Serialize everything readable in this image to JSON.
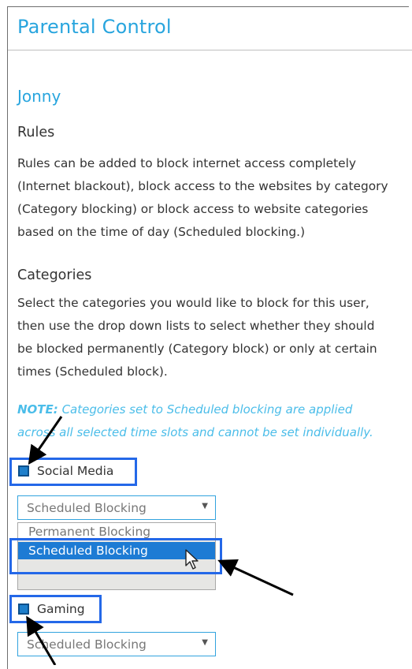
{
  "page": {
    "title": "Parental Control"
  },
  "user": {
    "name": "Jonny"
  },
  "rules": {
    "heading": "Rules",
    "lines": [
      "Rules can be added to block internet access completely",
      "(Internet blackout), block access to the websites by category",
      "(Category blocking) or block access to website categories",
      "based on the time of day (Scheduled blocking.)"
    ]
  },
  "categories": {
    "heading": "Categories",
    "lines": [
      "Select the categories you would like to block for this user,",
      "then use the drop down lists to select whether they should",
      "be blocked permanently (Category block) or only at certain",
      "times (Scheduled block)."
    ]
  },
  "note": {
    "prefix": "NOTE:",
    "line1": " Categories set to Scheduled blocking are applied",
    "line2": "across all selected time slots and cannot be set individually."
  },
  "social_media": {
    "label": "Social Media",
    "checked": true,
    "select_value": "Scheduled Blocking",
    "options": [
      "Permanent Blocking",
      "Scheduled Blocking"
    ],
    "highlighted_option": "Scheduled Blocking"
  },
  "gaming": {
    "label": "Gaming",
    "checked": true,
    "select_value": "Scheduled Blocking"
  },
  "colors": {
    "accent": "#28a5de",
    "note_text": "#4bbde9",
    "highlight_box": "#2468e8",
    "selected_option": "#1d7bd4",
    "checkbox_fill": "#1e7fcb",
    "annotation_arrow": "#000000"
  },
  "icons": {
    "select_arrow": "chevron-down-icon",
    "mouse_pointer": "mouse-pointer-icon",
    "annotation": "arrow-annotation-icon"
  }
}
